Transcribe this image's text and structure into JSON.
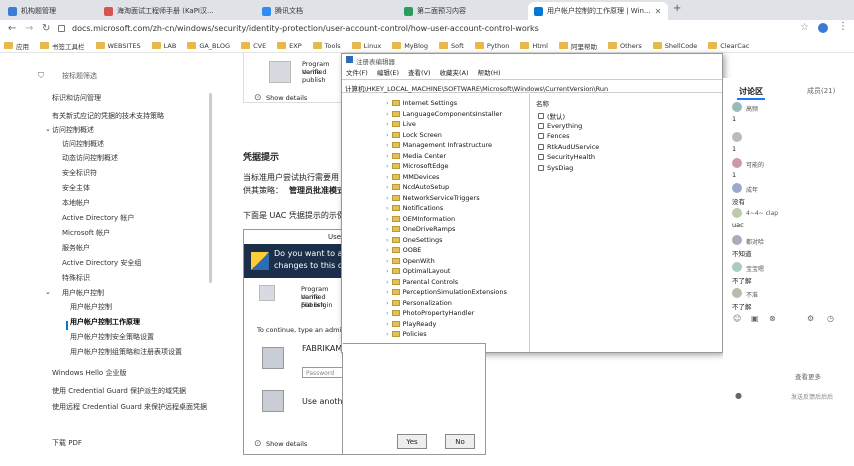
{
  "tabs": [
    {
      "label": "机构题管理",
      "color": "#3b7dd8"
    },
    {
      "label": "海淘面试工程师手册 (KaPI汉...",
      "color": "#d9534f"
    },
    {
      "label": "腾讯文档",
      "color": "#2f8cf0"
    },
    {
      "label": "第二面预习内容",
      "color": "#2a9d5c"
    },
    {
      "label": "用户帐户控制的工作原理 | Win...",
      "color": "#0078d4"
    }
  ],
  "address": {
    "url": "docs.microsoft.com/zh-cn/windows/security/identity-protection/user-account-control/how-user-account-control-works"
  },
  "bookmarks": [
    "应用",
    "书签工具栏",
    "WEBSITES",
    "LAB",
    "GA_BLOG",
    "CVE",
    "EXP",
    "Tools",
    "Linux",
    "MyBlog",
    "Soft",
    "Python",
    "Html",
    "阿里帮助",
    "Others",
    "ShellCode",
    "ClearCac"
  ],
  "leftnav": {
    "filter_label": "按标题筛选",
    "items": [
      "标识和访问管理",
      "有关新式应记的凭据的技术支持策略",
      "访问控制概述",
      "访问控制概述",
      "动态访问控制概述",
      "安全标识符",
      "安全主体",
      "本地帐户",
      "Active Directory 帐户",
      "Microsoft 帐户",
      "服务帐户",
      "Active Directory 安全组",
      "特殊标识",
      "用户帐户控制",
      "用户帐户控制",
      "用户帐户控制工作原理",
      "用户帐户控制安全策略设置",
      "用户帐户控制组策略和注册表项设置",
      "Windows Hello 企业版",
      "使用 Credential Guard 保护派生的域凭据",
      "使用远程 Credential Guard 来保护远程桌面凭据",
      "下载 PDF"
    ]
  },
  "doc": {
    "program_name_label": "Program name",
    "verified_publisher_label": "Verified publish",
    "show_details": "Show details",
    "section_heading": "凭据提示",
    "para1": "当标准用户尝试执行需要用",
    "para2": "供其策略：",
    "para2_bold": "管理员批准模式",
    "para3": "下面是 UAC 凭据提示的示例",
    "dialog_title_partial": "Use",
    "dialog_question": "Do you want to allo",
    "dialog_question2": "changes to this com",
    "file_origin_label": "File origin",
    "continue_text": "To continue, type an administ",
    "account_name": "FABRIKAM\\",
    "password_placeholder": "Password",
    "use_another_account": "Use another account",
    "yes": "Yes",
    "no": "No"
  },
  "regedit": {
    "title": "注册表编辑器",
    "menu": [
      "文件(F)",
      "编辑(E)",
      "查看(V)",
      "收藏夹(A)",
      "帮助(H)"
    ],
    "path": "计算机\\HKEY_LOCAL_MACHINE\\SOFTWARE\\Microsoft\\Windows\\CurrentVersion\\Run",
    "keys": [
      "Internet Settings",
      "LanguageComponentsInstaller",
      "Live",
      "Lock Screen",
      "Management Infrastructure",
      "Media Center",
      "MicrosoftEdge",
      "MMDevices",
      "NcdAutoSetup",
      "NetworkServiceTriggers",
      "Notifications",
      "OEMInformation",
      "OneDriveRamps",
      "OneSettings",
      "OOBE",
      "OpenWith",
      "OptimalLayout",
      "Parental Controls",
      "PerceptionSimulationExtensions",
      "Personalization",
      "PhotoPropertyHandler",
      "PlayReady",
      "Policies"
    ],
    "values_header": "名称",
    "values": [
      "(默认)",
      "Everything",
      "Fences",
      "RtkAudUService",
      "SecurityHealth",
      "SysDiag"
    ]
  },
  "discussion": {
    "tab_active": "讨论区",
    "tab_other": "成员(21)",
    "comments": [
      {
        "user": "高频",
        "text": "1"
      },
      {
        "user": "",
        "text": "1"
      },
      {
        "user": "可能的",
        "text": "1"
      },
      {
        "user": "成年",
        "text": "没有"
      },
      {
        "user": "4~4~ clap",
        "text": "uac"
      },
      {
        "user": "都对哈",
        "text": "不知道"
      },
      {
        "user": "宝宝嗯",
        "text": "不了解"
      },
      {
        "user": "不准",
        "text": "不了解"
      }
    ],
    "more_label": "查看更多",
    "footer_text": "发送反馈后后后"
  }
}
